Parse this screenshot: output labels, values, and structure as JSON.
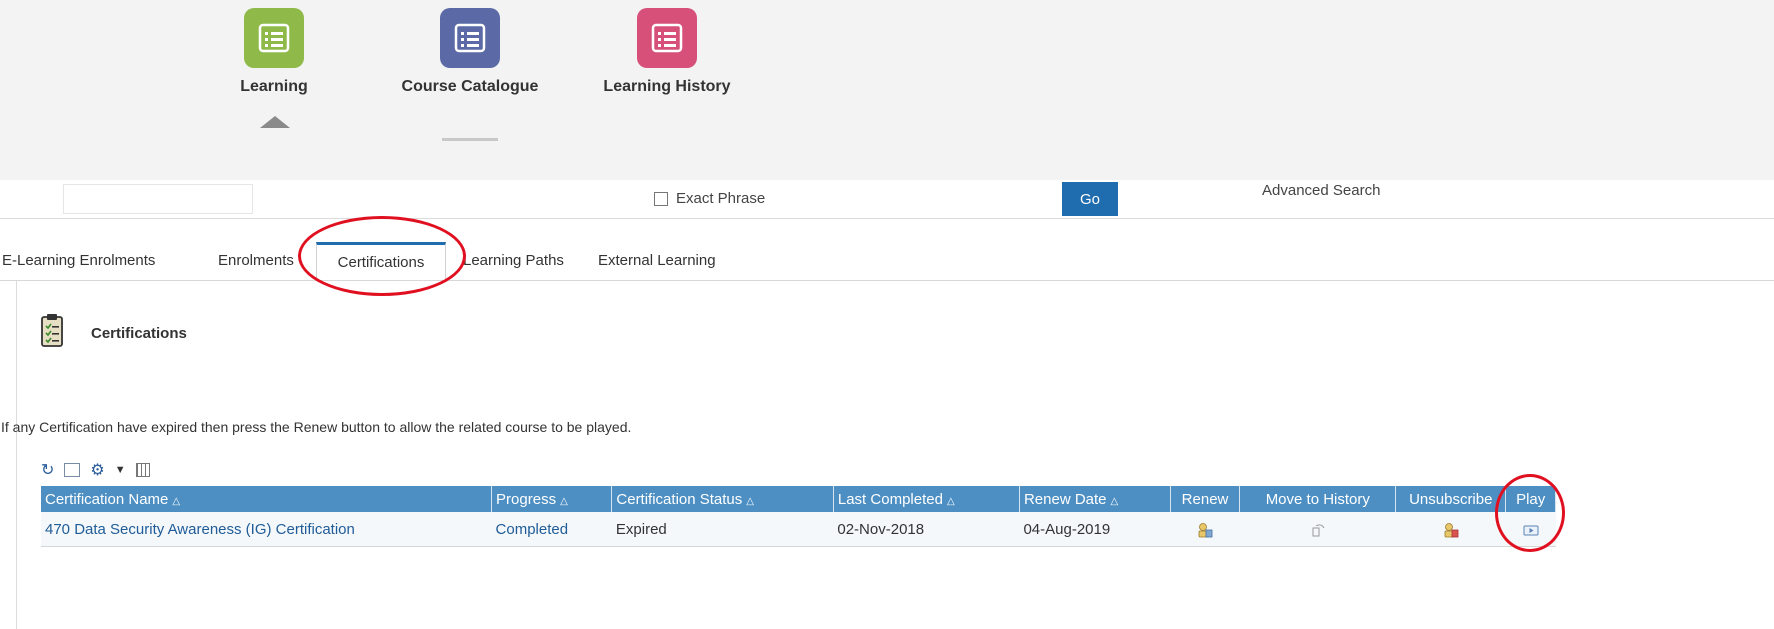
{
  "launcher": {
    "tiles": [
      {
        "label": "Learning",
        "color": "#8fba4a"
      },
      {
        "label": "Course Catalogue",
        "color": "#5b6aa6"
      },
      {
        "label": "Learning History",
        "color": "#d6507a"
      }
    ]
  },
  "search": {
    "value": "",
    "exact_phrase_label": "Exact Phrase",
    "go_label": "Go",
    "advanced_label": "Advanced Search"
  },
  "tabs": {
    "items": [
      "E-Learning Enrolments",
      "Enrolments",
      "Certifications",
      "Learning Paths",
      "External Learning"
    ],
    "active": "Certifications"
  },
  "section": {
    "title": "Certifications",
    "notice": "If any Certification have expired then press the Renew button to allow the related course to be played."
  },
  "table": {
    "columns": [
      "Certification Name",
      "Progress",
      "Certification Status",
      "Last Completed",
      "Renew Date",
      "Renew",
      "Move to History",
      "Unsubscribe",
      "Play"
    ],
    "rows": [
      {
        "name": "470 Data Security Awareness (IG) Certification",
        "progress": "Completed",
        "status": "Expired",
        "last_completed": "02-Nov-2018",
        "renew_date": "04-Aug-2019"
      }
    ]
  },
  "colors": {
    "accent": "#1f6cae",
    "header": "#4d8fc3",
    "annotation": "#e01020"
  },
  "icons": [
    "list-icon",
    "refresh-icon",
    "detach-icon",
    "gear-icon",
    "dropdown-caret-icon",
    "columns-icon",
    "renew-icon",
    "move-to-history-icon",
    "unsubscribe-icon",
    "play-icon",
    "clipboard-icon"
  ]
}
